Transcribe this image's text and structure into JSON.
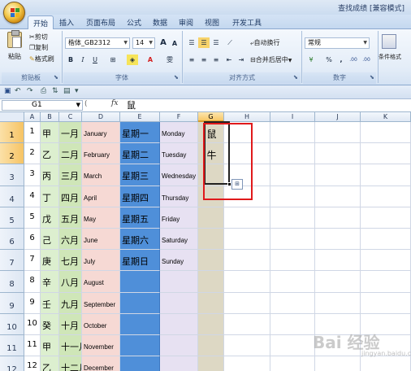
{
  "window": {
    "title": "查找成绩 [兼容模式]"
  },
  "tabs": [
    {
      "label": "开始",
      "active": true
    },
    {
      "label": "插入"
    },
    {
      "label": "页面布局"
    },
    {
      "label": "公式"
    },
    {
      "label": "数据"
    },
    {
      "label": "审阅"
    },
    {
      "label": "视图"
    },
    {
      "label": "开发工具"
    }
  ],
  "ribbon": {
    "clipboard": {
      "paste": "粘贴",
      "cut": "剪切",
      "copy": "复制",
      "format_painter": "格式刷",
      "group": "剪贴板"
    },
    "font": {
      "name": "楷体_GB2312",
      "size": "14",
      "grow": "A",
      "shrink": "A",
      "bold": "B",
      "italic": "I",
      "underline": "U",
      "phonetic": "雯",
      "group": "字体"
    },
    "alignment": {
      "wrap": "自动换行",
      "merge": "合并后居中",
      "group": "对齐方式"
    },
    "number": {
      "format": "常规",
      "percent": "%",
      "comma": ",",
      "inc_dec": ".00",
      "dec_dec": ".00",
      "group": "数字"
    },
    "styles": {
      "conditional": "条件格式"
    }
  },
  "formula_bar": {
    "name_box": "G1",
    "fx": "fx",
    "content": "鼠"
  },
  "sheet": {
    "columns": [
      "A",
      "B",
      "C",
      "D",
      "E",
      "F",
      "G",
      "H",
      "I",
      "J",
      "K"
    ],
    "rows": [
      {
        "num": "1",
        "A": "1",
        "B": "甲",
        "C": "一月",
        "D": "January",
        "E": "星期一",
        "F": "Monday",
        "G": "鼠"
      },
      {
        "num": "2",
        "A": "2",
        "B": "乙",
        "C": "二月",
        "D": "February",
        "E": "星期二",
        "F": "Tuesday",
        "G": "牛"
      },
      {
        "num": "3",
        "A": "3",
        "B": "丙",
        "C": "三月",
        "D": "March",
        "E": "星期三",
        "F": "Wednesday",
        "G": ""
      },
      {
        "num": "4",
        "A": "4",
        "B": "丁",
        "C": "四月",
        "D": "April",
        "E": "星期四",
        "F": "Thursday",
        "G": ""
      },
      {
        "num": "5",
        "A": "5",
        "B": "戊",
        "C": "五月",
        "D": "May",
        "E": "星期五",
        "F": "Friday",
        "G": ""
      },
      {
        "num": "6",
        "A": "6",
        "B": "己",
        "C": "六月",
        "D": "June",
        "E": "星期六",
        "F": "Saturday",
        "G": ""
      },
      {
        "num": "7",
        "A": "7",
        "B": "庚",
        "C": "七月",
        "D": "July",
        "E": "星期日",
        "F": "Sunday",
        "G": ""
      },
      {
        "num": "8",
        "A": "8",
        "B": "辛",
        "C": "八月",
        "D": "August",
        "E": "",
        "F": "",
        "G": ""
      },
      {
        "num": "9",
        "A": "9",
        "B": "壬",
        "C": "九月",
        "D": "September",
        "E": "",
        "F": "",
        "G": ""
      },
      {
        "num": "10",
        "A": "10",
        "B": "癸",
        "C": "十月",
        "D": "October",
        "E": "",
        "F": "",
        "G": ""
      },
      {
        "num": "11",
        "A": "11",
        "B": "甲",
        "C": "十一月",
        "D": "November",
        "E": "",
        "F": "",
        "G": ""
      },
      {
        "num": "12",
        "A": "12",
        "B": "乙",
        "C": "十二月",
        "D": "December",
        "E": "",
        "F": "",
        "G": ""
      }
    ],
    "column_colors": {
      "B": "#dcefcf",
      "C": "#cfe6b8",
      "D": "#f6d9d4",
      "E": "#4f8fd9",
      "F": "#e7e1f2",
      "G": "#ddd8c4"
    },
    "selected_column": "G",
    "selected_rows": [
      "1",
      "2"
    ],
    "autofill_icon": "autofill-options-icon"
  },
  "watermark": {
    "text": "Bai 经验",
    "sub": "jingyan.baidu.com"
  }
}
